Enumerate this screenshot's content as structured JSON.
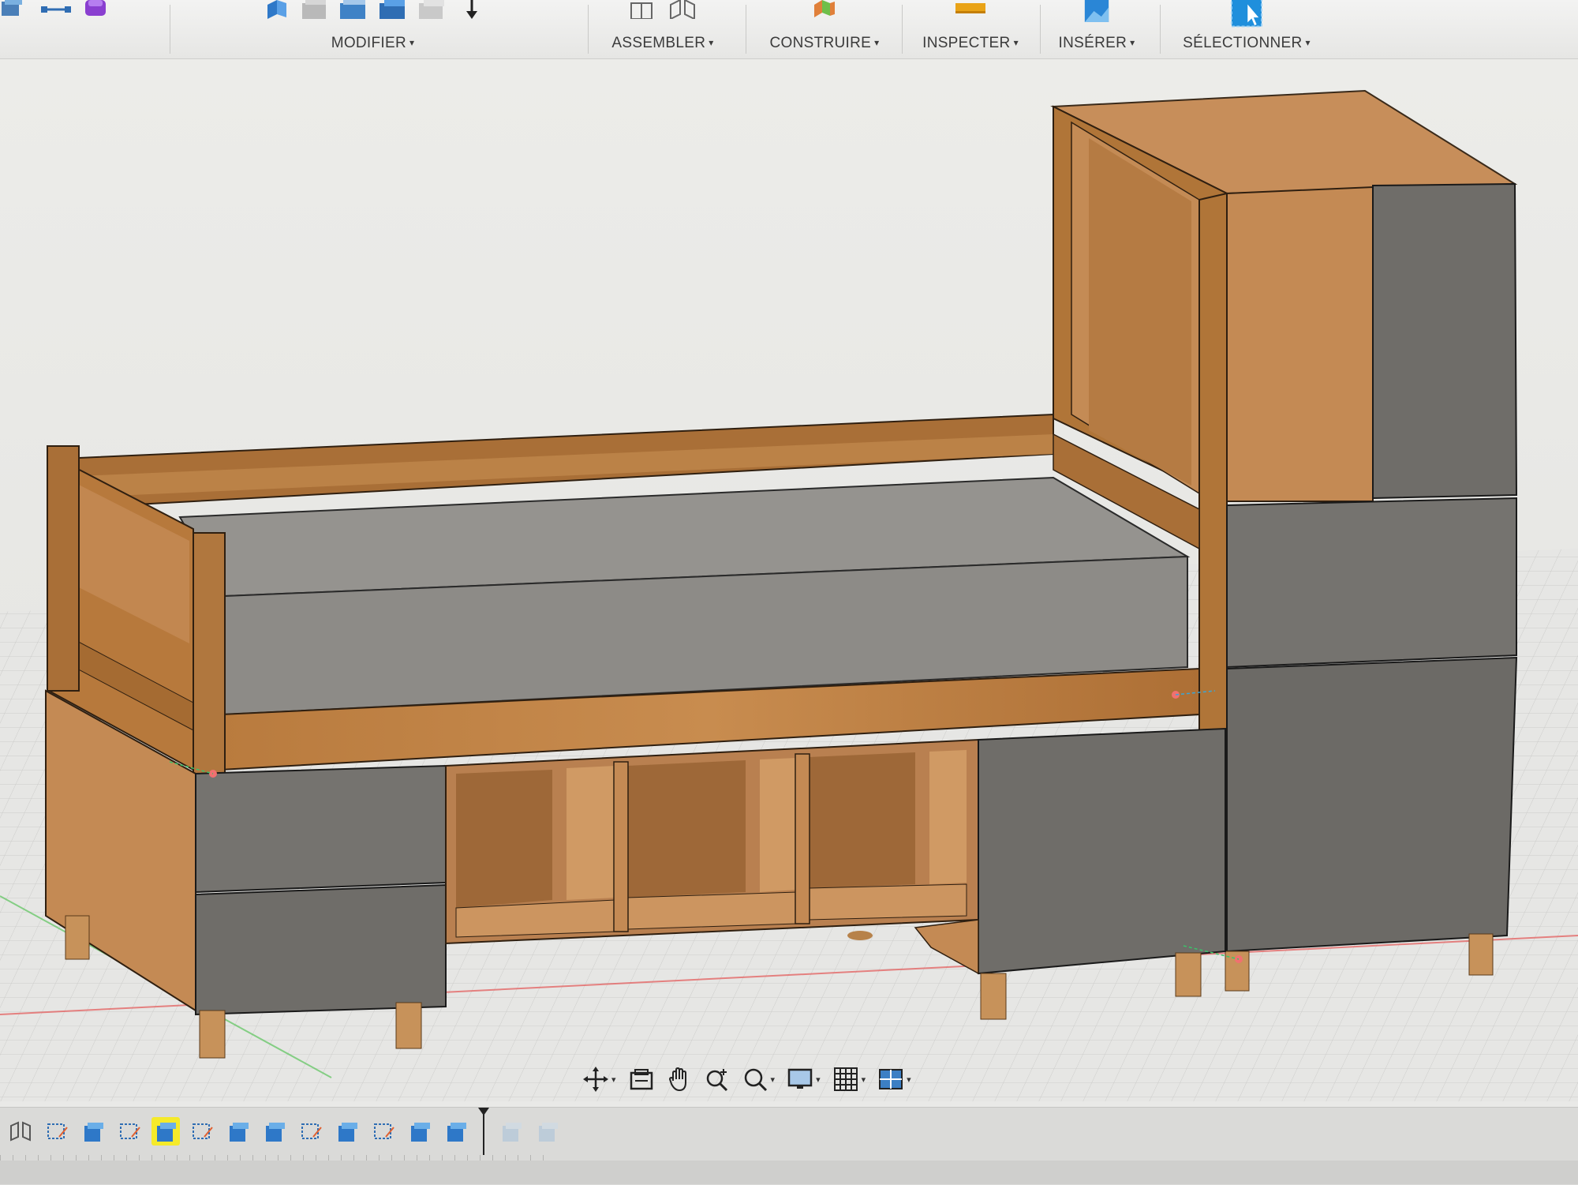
{
  "toolbar": {
    "groups": [
      {
        "id": "modify",
        "label": "MODIFIER"
      },
      {
        "id": "assemble",
        "label": "ASSEMBLER"
      },
      {
        "id": "construct",
        "label": "CONSTRUIRE"
      },
      {
        "id": "inspect",
        "label": "INSPECTER"
      },
      {
        "id": "insert",
        "label": "INSÉRER"
      },
      {
        "id": "select",
        "label": "SÉLECTIONNER"
      }
    ],
    "caret": "▾"
  },
  "navigation": {
    "items": [
      "orbit-icon",
      "look-at-icon",
      "pan-icon",
      "zoom-icon",
      "fit-icon",
      "display-settings-icon",
      "grid-settings-icon",
      "viewports-icon"
    ]
  },
  "colors": {
    "wood_light": "#c98f58",
    "wood_mid": "#b4783f",
    "wood_dark": "#8a5526",
    "panel_grey": "#6f6d69",
    "panel_grey_light": "#8a8884",
    "mattress": "#9c9a96",
    "grid": "#c9c9c9",
    "accent_blue": "#1f8fdc",
    "timeline_highlight": "#f5ea2a"
  }
}
